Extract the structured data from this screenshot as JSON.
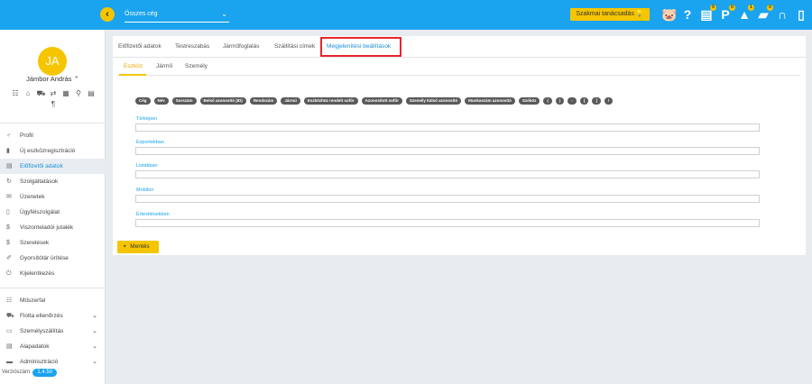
{
  "topbar": {
    "company_select": "Összes cég",
    "consult_button": "Szakmai tanácsadás",
    "icons": [
      {
        "name": "piggy-bank-icon",
        "glyph": "🐷",
        "badge": ""
      },
      {
        "name": "help-icon",
        "glyph": "?",
        "badge": ""
      },
      {
        "name": "document-icon",
        "glyph": "▤",
        "badge": "0"
      },
      {
        "name": "parking-icon",
        "glyph": "P",
        "badge": "0"
      },
      {
        "name": "bell-icon",
        "glyph": "▲",
        "badge": "1"
      },
      {
        "name": "chat-icon",
        "glyph": "▰",
        "badge": "0"
      },
      {
        "name": "headset-icon",
        "glyph": "∩",
        "badge": ""
      },
      {
        "name": "devices-icon",
        "glyph": "▯",
        "badge": ""
      }
    ],
    "accent": "#1aa3ee",
    "yellow": "#f5c500"
  },
  "sidebar": {
    "avatar": "JA",
    "username": "Jámbor András",
    "username_caret": "⌃",
    "quick_icons": [
      "☷",
      "⌂",
      "⛟",
      "⇄",
      "▦",
      "⚲",
      "▤",
      "¶"
    ],
    "nav": [
      {
        "label": "Profil",
        "icon": "♂",
        "name": "profile"
      },
      {
        "label": "Új eszközregisztráció",
        "icon": "▮",
        "name": "new-device"
      },
      {
        "label": "Előfizetői adatok",
        "icon": "▤",
        "name": "subscriber-data",
        "active": true
      },
      {
        "label": "Szolgáltatások",
        "icon": "↻",
        "name": "services"
      },
      {
        "label": "Üzenetek",
        "icon": "✉",
        "name": "messages"
      },
      {
        "label": "Ügyfélszolgálat",
        "icon": "▯",
        "name": "support"
      },
      {
        "label": "Viszonteladói jutalék",
        "icon": "$",
        "name": "reseller"
      },
      {
        "label": "Szerelések",
        "icon": "$",
        "name": "installations"
      },
      {
        "label": "Gyorsítótár ürítése",
        "icon": "✐",
        "name": "clear-cache"
      },
      {
        "label": "Kijelentkezés",
        "icon": "⏻",
        "name": "logout"
      }
    ],
    "nav2": [
      {
        "label": "Műszerfal",
        "icon": "☷",
        "name": "dashboard",
        "chev": ""
      },
      {
        "label": "Flotta ellenőrzés",
        "icon": "⛟",
        "name": "fleet-check",
        "chev": "⌄"
      },
      {
        "label": "Személyszállítás",
        "icon": "▭",
        "name": "passenger",
        "chev": "⌄"
      },
      {
        "label": "Alapadatok",
        "icon": "▤",
        "name": "base-data",
        "chev": "⌄"
      },
      {
        "label": "Adminisztráció",
        "icon": "▬",
        "name": "admin",
        "chev": "⌄"
      }
    ],
    "version_label": "Verziószám:",
    "version": "1.4.50"
  },
  "main": {
    "tabs": [
      "Előfizetői adatok",
      "Testreszabás",
      "Járműfoglalás",
      "Szállítási címek",
      "Megjelenítési beállítások"
    ],
    "active_tab": 4,
    "subtabs": [
      "Eszköz",
      "Jármű",
      "Személy"
    ],
    "active_subtab": 0,
    "chips": [
      "Cég",
      "Név",
      "Sorszám",
      "Belső azonosító (ID)",
      "Rendszám",
      "Jármű",
      "Eszközhöz rendelt sofőr",
      "Azonosított sofőr",
      "Személy külső azonosító",
      "Munkaszám azonosító",
      "Szóköz",
      "(",
      ")",
      "-",
      "[",
      "]",
      "/"
    ],
    "fields": [
      {
        "label": "Térképen",
        "value": ""
      },
      {
        "label": "Exportokban",
        "value": ""
      },
      {
        "label": "Listákban",
        "value": ""
      },
      {
        "label": "Mobilon",
        "value": ""
      },
      {
        "label": "Értesítésekben",
        "value": ""
      }
    ],
    "save_label": "Mentés",
    "highlight_color": "#e8262b"
  }
}
